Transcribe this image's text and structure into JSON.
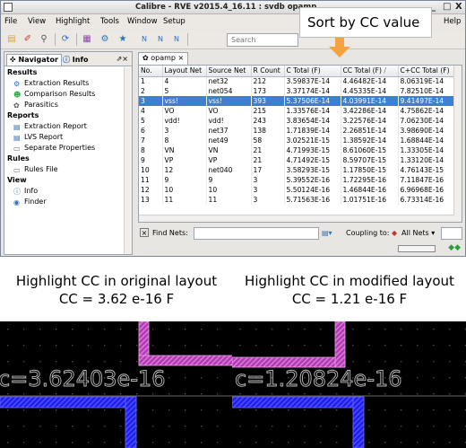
{
  "window": {
    "title": "Calibre - RVE v2015.4_16.11 : svdb opamp",
    "controls": [
      "_",
      "□",
      "X"
    ]
  },
  "menu": [
    {
      "label": "File"
    },
    {
      "label": "View"
    },
    {
      "label": "Highlight"
    },
    {
      "label": "Tools"
    },
    {
      "label": "Window"
    },
    {
      "label": "Setup"
    },
    {
      "label": "Help"
    }
  ],
  "toolbar": {
    "search_placeholder": "Search"
  },
  "navigator": {
    "tabs": [
      "Navigator",
      "Info"
    ],
    "items": [
      {
        "label": "Results",
        "kind": "section"
      },
      {
        "label": "Extraction Results",
        "kind": "item",
        "icon": "extraction-icon"
      },
      {
        "label": "Comparison Results",
        "kind": "item",
        "icon": "smiley-icon"
      },
      {
        "label": "Parasitics",
        "kind": "item",
        "icon": "parasitics-icon"
      },
      {
        "label": "Reports",
        "kind": "section"
      },
      {
        "label": "Extraction Report",
        "kind": "item",
        "icon": "report-icon"
      },
      {
        "label": "LVS Report",
        "kind": "item",
        "icon": "report-icon"
      },
      {
        "label": "Separate Properties",
        "kind": "item",
        "icon": "document-icon"
      },
      {
        "label": "Rules",
        "kind": "section"
      },
      {
        "label": "Rules File",
        "kind": "item",
        "icon": "document-icon"
      },
      {
        "label": "View",
        "kind": "section"
      },
      {
        "label": "Info",
        "kind": "item",
        "icon": "info-icon"
      },
      {
        "label": "Finder",
        "kind": "item",
        "icon": "binoculars-icon"
      }
    ]
  },
  "results": {
    "tab": "opamp",
    "columns": [
      "No.",
      "Layout Net",
      "Source Net",
      "R Count",
      "C Total (F)",
      "CC Total (F)",
      "C+CC Total (F)"
    ],
    "sort_indicator": "/",
    "selected_row": 2,
    "rows": [
      [
        "1",
        "4",
        "net32",
        "212",
        "3.59837E-14",
        "4.46482E-14",
        "8.06319E-14"
      ],
      [
        "2",
        "5",
        "net054",
        "173",
        "3.37174E-14",
        "4.45335E-14",
        "7.82510E-14"
      ],
      [
        "3",
        "vss!",
        "vss!",
        "393",
        "5.37506E-14",
        "4.03991E-14",
        "9.41497E-14"
      ],
      [
        "4",
        "VO",
        "VO",
        "215",
        "1.33576E-14",
        "3.42286E-14",
        "4.75862E-14"
      ],
      [
        "5",
        "vdd!",
        "vdd!",
        "243",
        "3.83654E-14",
        "3.22576E-14",
        "7.06230E-14"
      ],
      [
        "6",
        "3",
        "net37",
        "138",
        "1.71839E-14",
        "2.26851E-14",
        "3.98690E-14"
      ],
      [
        "7",
        "8",
        "net49",
        "58",
        "3.02521E-15",
        "1.38592E-14",
        "1.68844E-14"
      ],
      [
        "8",
        "VN",
        "VN",
        "21",
        "4.71993E-15",
        "8.61060E-15",
        "1.33305E-14"
      ],
      [
        "9",
        "VP",
        "VP",
        "21",
        "4.71492E-15",
        "8.59707E-15",
        "1.33120E-14"
      ],
      [
        "10",
        "12",
        "net040",
        "17",
        "3.58293E-15",
        "1.17850E-15",
        "4.76143E-15"
      ],
      [
        "11",
        "9",
        "9",
        "3",
        "5.39552E-16",
        "1.72295E-16",
        "7.11847E-16"
      ],
      [
        "12",
        "10",
        "10",
        "3",
        "5.50124E-16",
        "1.46844E-16",
        "6.96968E-16"
      ],
      [
        "13",
        "11",
        "11",
        "3",
        "5.71563E-16",
        "1.01751E-16",
        "6.73314E-16"
      ]
    ],
    "find_label": "Find Nets:",
    "coupling_label": "Coupling to:",
    "coupling_value": "All Nets"
  },
  "callout": {
    "text": "Sort by CC value",
    "arrow_color": "#f4a340"
  },
  "captions": {
    "original_title": "Highlight CC in original layout",
    "original_value": "CC = 3.62 e-16 F",
    "modified_title": "Highlight CC in modified layout",
    "modified_value": "CC = 1.21 e-16 F"
  },
  "layouts": {
    "original_label": "c=3.62403e-16",
    "modified_label": "c=1.20824e-16",
    "colors": {
      "background": "#000000",
      "magenta": "#cc44cc",
      "blue": "#2b2bff",
      "label": "#bdbdbd"
    }
  }
}
